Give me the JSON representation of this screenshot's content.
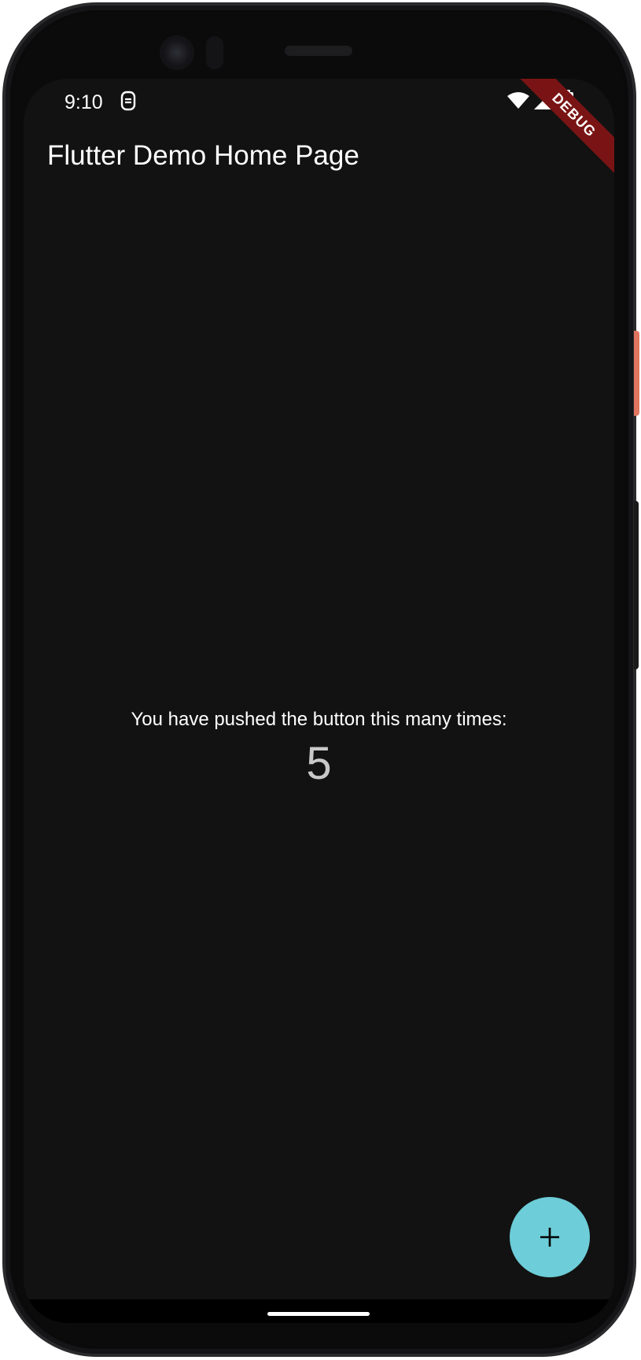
{
  "status_bar": {
    "time": "9:10",
    "icons": [
      "notification-icon",
      "wifi-icon",
      "signal-icon",
      "battery-icon"
    ]
  },
  "debug_banner": {
    "label": "DEBUG"
  },
  "app_bar": {
    "title": "Flutter Demo Home Page"
  },
  "main": {
    "counter_label": "You have pushed the button this many times:",
    "counter_value": "5"
  },
  "fab": {
    "icon": "plus-icon",
    "color": "#6dcdd8"
  },
  "colors": {
    "background": "#121212",
    "debug_banner": "#7a1414",
    "counter_value": "#c8c8c8"
  }
}
